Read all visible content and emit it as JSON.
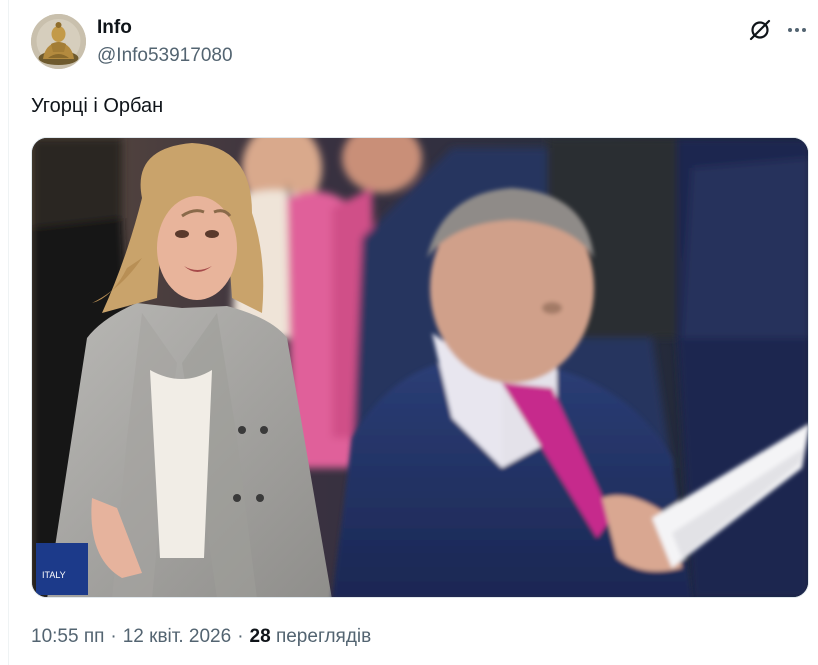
{
  "author": {
    "display_name": "Info",
    "handle": "@Info53917080",
    "avatar_icon": "buddha-statue-avatar"
  },
  "actions": {
    "grok_icon": "grok-icon",
    "more_icon": "more-icon"
  },
  "tweet": {
    "text": "Угорці і Орбан"
  },
  "media": {
    "type": "photo",
    "sign_text": "ITALY"
  },
  "meta": {
    "time": "10:55 пп",
    "separator": "·",
    "date": "12 квіт. 2026",
    "views_count": "28",
    "views_label": "переглядів"
  },
  "colors": {
    "text_primary": "#0f1419",
    "text_secondary": "#536471",
    "border": "#eff3f4"
  }
}
